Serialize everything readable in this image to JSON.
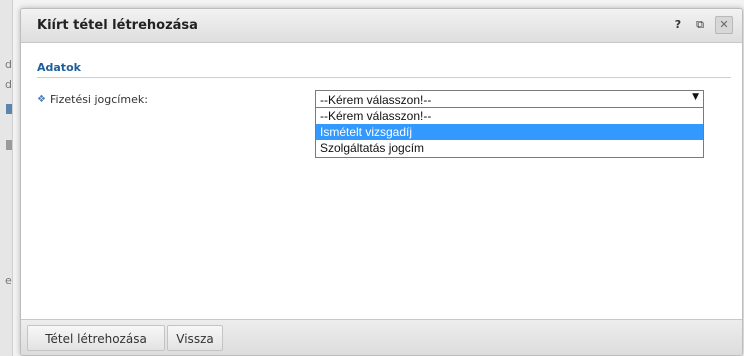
{
  "background": {
    "letters": [
      "d",
      "d",
      "e"
    ]
  },
  "dialog": {
    "title": "Kiírt tétel létrehozása",
    "controls": {
      "help": "?",
      "popout": "⧉",
      "close": "✕"
    }
  },
  "section": {
    "title": "Adatok"
  },
  "field": {
    "bullet": "❖",
    "label": "Fizetési jogcímek:",
    "select": {
      "value": "--Kérem válasszon!--",
      "arrow": "▼",
      "options": [
        {
          "label": "--Kérem válasszon!--",
          "selected": false
        },
        {
          "label": "Ismételt vizsgadíj",
          "selected": true
        },
        {
          "label": "Szolgáltatás jogcím",
          "selected": false
        }
      ]
    }
  },
  "footer": {
    "create_label": "Tétel létrehozása",
    "back_label": "Vissza"
  },
  "colors": {
    "accent": "#1f5f99",
    "selection": "#3399ff"
  }
}
